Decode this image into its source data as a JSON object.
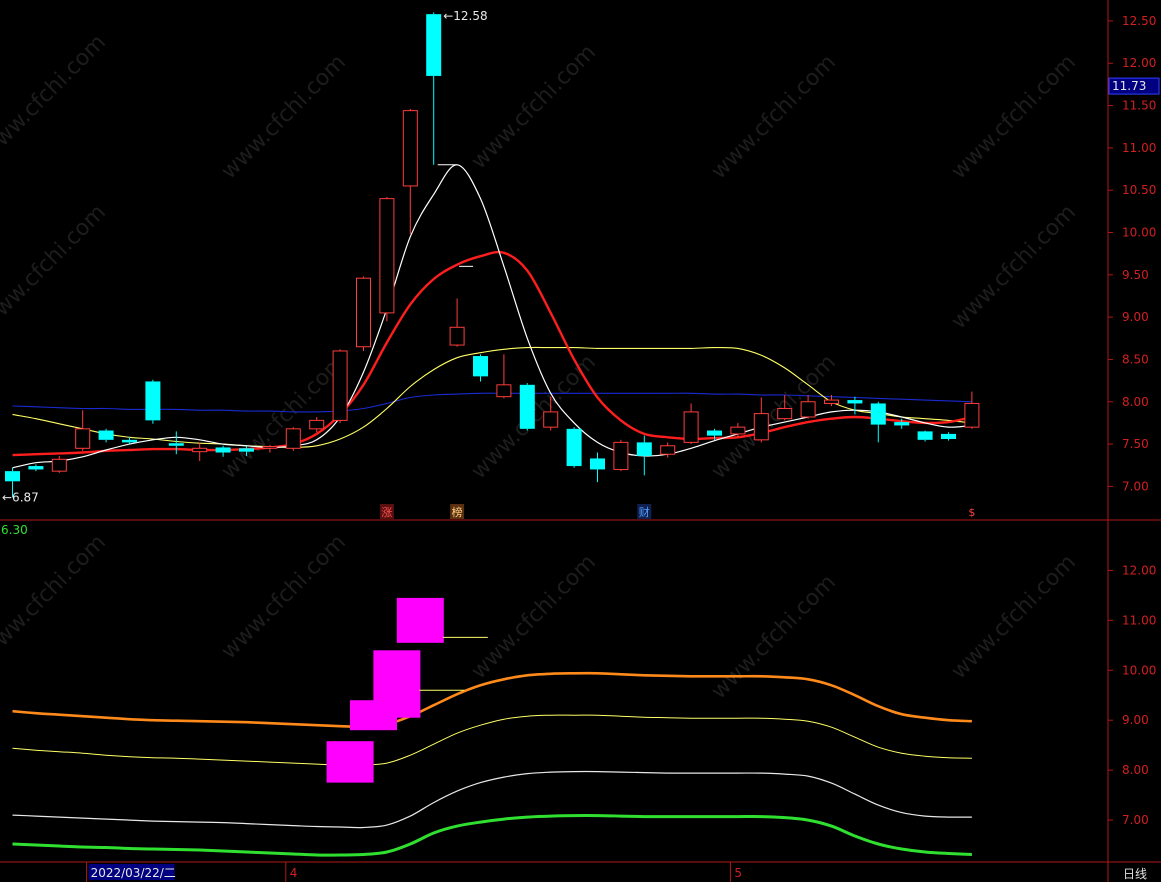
{
  "chart_data": [
    {
      "type": "candlestick",
      "panel": "main",
      "ylim": [
        6.65,
        12.7
      ],
      "yticks": [
        "7.00",
        "7.50",
        "8.00",
        "8.50",
        "9.00",
        "9.50",
        "10.00",
        "10.50",
        "11.00",
        "11.50",
        "12.00",
        "12.50"
      ],
      "current_price_label": "11.73",
      "high_annotation": "12.58",
      "low_annotation": "6.87",
      "candles": [
        {
          "o": 7.18,
          "c": 7.06,
          "h": 7.22,
          "l": 6.87
        },
        {
          "o": 7.24,
          "c": 7.2,
          "h": 7.26,
          "l": 7.18
        },
        {
          "o": 7.18,
          "c": 7.32,
          "h": 7.36,
          "l": 7.16
        },
        {
          "o": 7.45,
          "c": 7.68,
          "h": 7.9,
          "l": 7.42
        },
        {
          "o": 7.66,
          "c": 7.55,
          "h": 7.68,
          "l": 7.52
        },
        {
          "o": 7.55,
          "c": 7.52,
          "h": 7.58,
          "l": 7.5
        },
        {
          "o": 8.24,
          "c": 7.78,
          "h": 8.26,
          "l": 7.74
        },
        {
          "o": 7.51,
          "c": 7.48,
          "h": 7.65,
          "l": 7.38
        },
        {
          "o": 7.41,
          "c": 7.45,
          "h": 7.52,
          "l": 7.3
        },
        {
          "o": 7.46,
          "c": 7.4,
          "h": 7.48,
          "l": 7.35
        },
        {
          "o": 7.45,
          "c": 7.41,
          "h": 7.47,
          "l": 7.36
        },
        {
          "o": 7.45,
          "c": 7.47,
          "h": 7.49,
          "l": 7.4
        },
        {
          "o": 7.45,
          "c": 7.68,
          "h": 7.7,
          "l": 7.42
        },
        {
          "o": 7.68,
          "c": 7.78,
          "h": 7.82,
          "l": 7.64
        },
        {
          "o": 7.78,
          "c": 8.6,
          "h": 8.62,
          "l": 7.75
        },
        {
          "o": 8.65,
          "c": 9.46,
          "h": 9.48,
          "l": 8.6
        },
        {
          "o": 9.05,
          "c": 10.4,
          "h": 10.42,
          "l": 8.95
        },
        {
          "o": 10.55,
          "c": 11.44,
          "h": 11.46,
          "l": 9.98
        },
        {
          "o": 12.58,
          "c": 11.85,
          "h": 12.6,
          "l": 10.8
        },
        {
          "o": 8.67,
          "c": 8.88,
          "h": 9.22,
          "l": 8.65
        },
        {
          "o": 8.54,
          "c": 8.3,
          "h": 8.56,
          "l": 8.24
        },
        {
          "o": 8.06,
          "c": 8.2,
          "h": 8.56,
          "l": 8.04
        },
        {
          "o": 8.2,
          "c": 7.68,
          "h": 8.22,
          "l": 7.66
        },
        {
          "o": 7.7,
          "c": 7.88,
          "h": 8.06,
          "l": 7.66
        },
        {
          "o": 7.68,
          "c": 7.24,
          "h": 7.7,
          "l": 7.22
        },
        {
          "o": 7.33,
          "c": 7.2,
          "h": 7.4,
          "l": 7.05
        },
        {
          "o": 7.2,
          "c": 7.52,
          "h": 7.55,
          "l": 7.18
        },
        {
          "o": 7.52,
          "c": 7.36,
          "h": 7.6,
          "l": 7.13
        },
        {
          "o": 7.38,
          "c": 7.48,
          "h": 7.52,
          "l": 7.34
        },
        {
          "o": 7.52,
          "c": 7.88,
          "h": 7.98,
          "l": 7.5
        },
        {
          "o": 7.66,
          "c": 7.6,
          "h": 7.68,
          "l": 7.55
        },
        {
          "o": 7.62,
          "c": 7.7,
          "h": 7.75,
          "l": 7.58
        },
        {
          "o": 7.55,
          "c": 7.86,
          "h": 8.05,
          "l": 7.52
        },
        {
          "o": 7.8,
          "c": 7.92,
          "h": 8.08,
          "l": 7.78
        },
        {
          "o": 7.82,
          "c": 8.0,
          "h": 8.08,
          "l": 7.8
        },
        {
          "o": 7.98,
          "c": 8.02,
          "h": 8.08,
          "l": 7.95
        },
        {
          "o": 8.02,
          "c": 7.98,
          "h": 8.06,
          "l": 7.85
        },
        {
          "o": 7.98,
          "c": 7.73,
          "h": 8.0,
          "l": 7.52
        },
        {
          "o": 7.76,
          "c": 7.72,
          "h": 7.8,
          "l": 7.68
        },
        {
          "o": 7.65,
          "c": 7.55,
          "h": 7.66,
          "l": 7.53
        },
        {
          "o": 7.62,
          "c": 7.56,
          "h": 7.64,
          "l": 7.54
        },
        {
          "o": 7.7,
          "c": 7.98,
          "h": 8.12,
          "l": 7.68
        }
      ],
      "series": [
        {
          "color": "#ffffff",
          "values": [
            7.22,
            7.28,
            7.3,
            7.35,
            7.43,
            7.5,
            7.55,
            7.58,
            7.55,
            7.5,
            7.48,
            7.46,
            7.48,
            7.55,
            7.82,
            8.35,
            9.1,
            9.95,
            10.45,
            10.8,
            10.4,
            9.6,
            8.75,
            8.1,
            7.75,
            7.52,
            7.4,
            7.36,
            7.38,
            7.45,
            7.54,
            7.62,
            7.7,
            7.76,
            7.82,
            7.88,
            7.9,
            7.88,
            7.82,
            7.75,
            7.7,
            7.72
          ]
        },
        {
          "color": "#ff1e1e",
          "values": [
            7.37,
            7.38,
            7.39,
            7.4,
            7.42,
            7.43,
            7.44,
            7.44,
            7.43,
            7.43,
            7.44,
            7.46,
            7.5,
            7.62,
            7.85,
            8.2,
            8.7,
            9.15,
            9.45,
            9.62,
            9.72,
            9.76,
            9.55,
            9.05,
            8.5,
            8.05,
            7.78,
            7.62,
            7.58,
            7.56,
            7.57,
            7.58,
            7.63,
            7.7,
            7.76,
            7.8,
            7.82,
            7.8,
            7.77,
            7.75,
            7.76,
            7.82
          ]
        },
        {
          "color": "#ffff66",
          "values": [
            7.85,
            7.8,
            7.74,
            7.68,
            7.62,
            7.58,
            7.56,
            7.53,
            7.51,
            7.5,
            7.48,
            7.47,
            7.46,
            7.48,
            7.56,
            7.7,
            7.92,
            8.18,
            8.38,
            8.52,
            8.58,
            8.62,
            8.64,
            8.64,
            8.64,
            8.63,
            8.63,
            8.63,
            8.63,
            8.63,
            8.64,
            8.63,
            8.55,
            8.4,
            8.2,
            8.0,
            7.9,
            7.86,
            7.82,
            7.8,
            7.78,
            7.75
          ]
        },
        {
          "color": "#1a2ad0",
          "values": [
            7.95,
            7.94,
            7.93,
            7.92,
            7.92,
            7.91,
            7.91,
            7.91,
            7.9,
            7.9,
            7.89,
            7.89,
            7.88,
            7.88,
            7.89,
            7.92,
            7.98,
            8.05,
            8.08,
            8.09,
            8.1,
            8.1,
            8.1,
            8.1,
            8.1,
            8.1,
            8.1,
            8.1,
            8.1,
            8.1,
            8.09,
            8.09,
            8.08,
            8.08,
            8.07,
            8.06,
            8.05,
            8.04,
            8.03,
            8.02,
            8.01,
            8.0
          ]
        }
      ],
      "event_markers": [
        {
          "index": 16,
          "text": "涨",
          "color": "#ff5050",
          "bg": "#5a1010"
        },
        {
          "index": 19,
          "text": "榜",
          "color": "#ffd080",
          "bg": "#5a3010"
        },
        {
          "index": 27,
          "text": "财",
          "color": "#50a0ff",
          "bg": "#102050"
        },
        {
          "index": 41,
          "text": "$",
          "color": "#ff4040",
          "bg": "#000000"
        }
      ]
    },
    {
      "type": "band-indicator",
      "panel": "sub",
      "ylim": [
        6.2,
        12.95
      ],
      "yticks": [
        "7.00",
        "8.00",
        "9.00",
        "10.00",
        "11.00",
        "12.00"
      ],
      "value_label": "6.30",
      "series": [
        {
          "color": "#ff8a1a",
          "values": [
            9.18,
            9.14,
            9.11,
            9.08,
            9.05,
            9.02,
            9.0,
            8.99,
            8.98,
            8.97,
            8.96,
            8.94,
            8.92,
            8.9,
            8.88,
            8.87,
            8.92,
            9.08,
            9.3,
            9.52,
            9.7,
            9.82,
            9.9,
            9.93,
            9.94,
            9.94,
            9.92,
            9.9,
            9.89,
            9.88,
            9.88,
            9.88,
            9.88,
            9.86,
            9.82,
            9.7,
            9.5,
            9.28,
            9.12,
            9.05,
            9.0,
            8.98
          ]
        },
        {
          "color": "#ffff66",
          "values": [
            8.44,
            8.4,
            8.37,
            8.34,
            8.3,
            8.27,
            8.25,
            8.24,
            8.22,
            8.2,
            8.18,
            8.16,
            8.14,
            8.12,
            8.1,
            8.1,
            8.14,
            8.3,
            8.52,
            8.74,
            8.9,
            9.02,
            9.08,
            9.1,
            9.1,
            9.1,
            9.08,
            9.06,
            9.05,
            9.04,
            9.04,
            9.04,
            9.04,
            9.02,
            8.98,
            8.86,
            8.66,
            8.46,
            8.34,
            8.28,
            8.25,
            8.24
          ]
        },
        {
          "color": "#e8e8e8",
          "values": [
            7.1,
            7.08,
            7.06,
            7.04,
            7.02,
            7.0,
            6.98,
            6.97,
            6.96,
            6.95,
            6.93,
            6.91,
            6.89,
            6.87,
            6.86,
            6.85,
            6.9,
            7.08,
            7.35,
            7.58,
            7.75,
            7.86,
            7.93,
            7.96,
            7.97,
            7.97,
            7.96,
            7.95,
            7.94,
            7.94,
            7.94,
            7.94,
            7.94,
            7.92,
            7.88,
            7.74,
            7.52,
            7.3,
            7.15,
            7.08,
            7.06,
            7.06
          ]
        },
        {
          "color": "#30e030",
          "values": [
            6.52,
            6.5,
            6.48,
            6.46,
            6.45,
            6.43,
            6.42,
            6.41,
            6.4,
            6.38,
            6.36,
            6.34,
            6.32,
            6.3,
            6.3,
            6.31,
            6.36,
            6.52,
            6.74,
            6.88,
            6.96,
            7.02,
            7.06,
            7.08,
            7.09,
            7.09,
            7.08,
            7.07,
            7.07,
            7.07,
            7.07,
            7.07,
            7.07,
            7.05,
            7.0,
            6.88,
            6.68,
            6.52,
            6.42,
            6.36,
            6.33,
            6.31
          ]
        }
      ],
      "blocks": [
        {
          "index": 14,
          "top": 8.58,
          "bottom": 7.75
        },
        {
          "index": 15,
          "top": 9.4,
          "bottom": 8.8
        },
        {
          "index": 16,
          "top": 10.4,
          "bottom": 9.05
        },
        {
          "index": 17,
          "top": 11.45,
          "bottom": 10.55
        }
      ],
      "block_color": "#ff00ff",
      "ref_lines": [
        {
          "index": 17,
          "value": 10.66
        },
        {
          "index": 16,
          "value": 9.6
        }
      ]
    }
  ],
  "date_axis": {
    "labels": [
      {
        "index": 4,
        "text": "2022/03/22/二",
        "highlight": true
      },
      {
        "index": 12,
        "text": "4",
        "highlight": false
      },
      {
        "index": 31,
        "text": "5",
        "highlight": false
      }
    ]
  },
  "watermark": "www.cfchi.com",
  "period_label": "日线",
  "colors": {
    "up": "#ff3c3c",
    "down": "#00ffff",
    "axis": "#b01818",
    "background": "#000000",
    "label_box": "#000080"
  }
}
